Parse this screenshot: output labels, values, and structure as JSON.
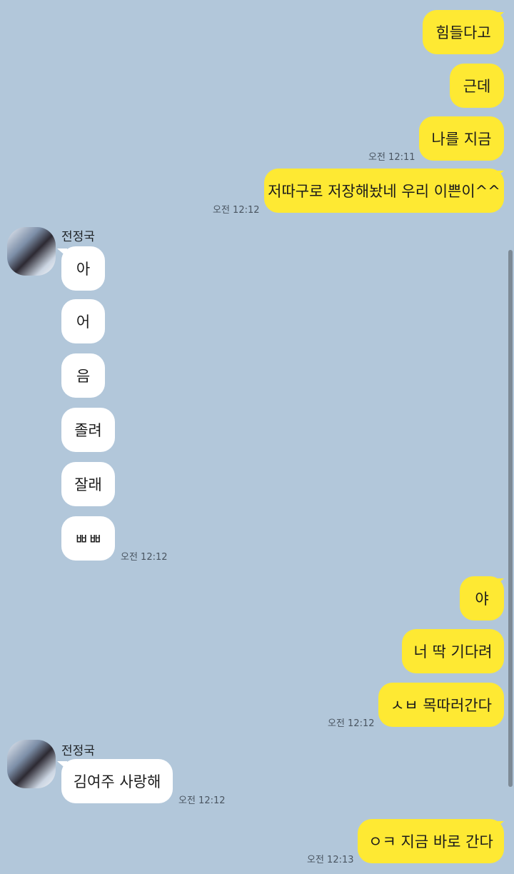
{
  "messages": {
    "m1": {
      "text": "힘들다고"
    },
    "m2": {
      "text": "근데"
    },
    "m3": {
      "text": "나를 지금",
      "time": "오전 12:11"
    },
    "m4": {
      "text": "저따구로 저장해놨네 우리 이쁜이^^",
      "time": "오전 12:12"
    },
    "sender1": {
      "name": "전정국"
    },
    "r1": {
      "text": "아"
    },
    "r2": {
      "text": "어"
    },
    "r3": {
      "text": "음"
    },
    "r4": {
      "text": "졸려"
    },
    "r5": {
      "text": "잘래"
    },
    "r6": {
      "text": "ㅃㅃ",
      "time": "오전 12:12"
    },
    "m5": {
      "text": "야"
    },
    "m6": {
      "text": "너 딱 기다려"
    },
    "m7": {
      "text": "ㅅㅂ 목따러간다",
      "time": "오전 12:12"
    },
    "sender2": {
      "name": "전정국"
    },
    "r7": {
      "text": "김여주 사랑해",
      "time": "오전 12:12"
    },
    "m8": {
      "text": "ㅇㅋ 지금 바로 간다",
      "time": "오전 12:13"
    }
  },
  "colors": {
    "background": "#b2c7da",
    "my_bubble": "#fee933",
    "their_bubble": "#ffffff"
  }
}
